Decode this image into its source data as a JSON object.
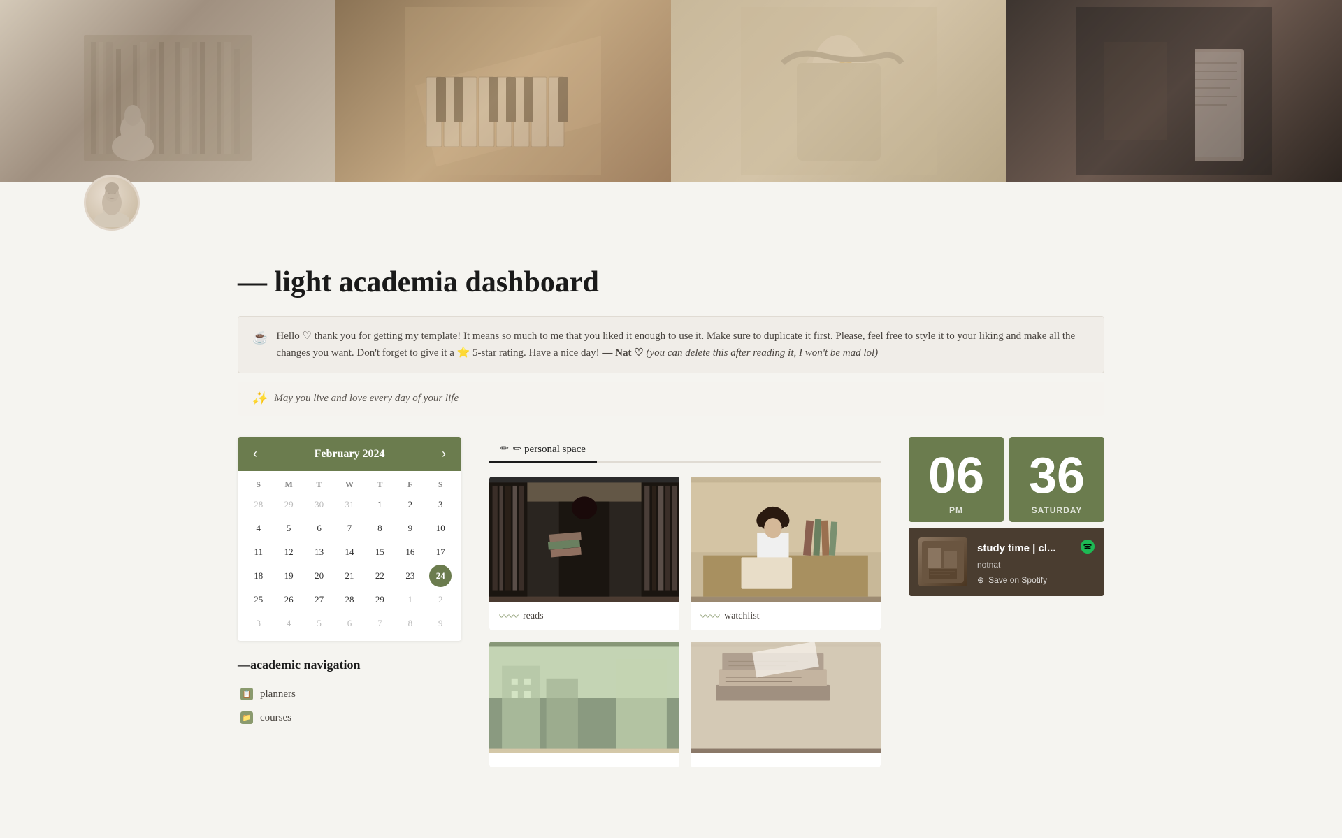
{
  "hero": {
    "panels": [
      {
        "label": "library",
        "emoji": "📚"
      },
      {
        "label": "piano",
        "emoji": "🎹"
      },
      {
        "label": "bag",
        "emoji": "👜"
      },
      {
        "label": "reading",
        "emoji": "📖"
      }
    ]
  },
  "bust": {
    "emoji": "🗿"
  },
  "page": {
    "title": "— light academia dashboard",
    "info_icon": "☕",
    "info_text": "Hello ♡ thank you for getting my template! It means so much to me that you liked it enough to use it. Make sure to duplicate it first. Please, feel free to style it to your liking and make all the changes you want. Don't forget to give it a ⭐ 5-star rating. Have a nice day!",
    "info_author": "— Nat ♡",
    "info_aside": "(you can delete this after reading it, I won't be mad lol)",
    "sparkle": "✨",
    "quote": "May you live and love every day of your life"
  },
  "calendar": {
    "month": "February 2024",
    "prev_label": "‹",
    "next_label": "›",
    "day_headers": [
      "S",
      "M",
      "T",
      "W",
      "T",
      "F",
      "S"
    ],
    "weeks": [
      [
        "28",
        "29",
        "30",
        "31",
        "1",
        "2",
        "3"
      ],
      [
        "4",
        "5",
        "6",
        "7",
        "8",
        "9",
        "10"
      ],
      [
        "11",
        "12",
        "13",
        "14",
        "15",
        "16",
        "17"
      ],
      [
        "18",
        "19",
        "20",
        "21",
        "22",
        "23",
        "24"
      ],
      [
        "25",
        "26",
        "27",
        "28",
        "29",
        "1",
        "2"
      ],
      [
        "3",
        "4",
        "5",
        "6",
        "7",
        "8",
        "9"
      ]
    ],
    "other_month_start": [
      "28",
      "29",
      "30",
      "31"
    ],
    "other_month_end_row4": [
      "1",
      "2"
    ],
    "other_month_end_row5": [
      "1",
      "2"
    ],
    "other_month_end_row6": [
      "3",
      "4",
      "5",
      "6",
      "7",
      "8",
      "9"
    ],
    "today": "24"
  },
  "academic_nav": {
    "title": "—academic navigation",
    "items": [
      {
        "label": "planners",
        "icon": "📋"
      },
      {
        "label": "courses",
        "icon": "📁"
      }
    ]
  },
  "personal_space": {
    "tabs": [
      {
        "label": "✏ personal space",
        "active": true
      }
    ],
    "photos": [
      {
        "label": "reads",
        "tilde": "〰〰"
      },
      {
        "label": "watchlist",
        "tilde": "〰〰"
      },
      {
        "label": "",
        "tilde": ""
      },
      {
        "label": "",
        "tilde": ""
      }
    ]
  },
  "clock": {
    "hour": "06",
    "minute": "36",
    "period": "PM",
    "day": "SATURDAY"
  },
  "spotify": {
    "logo": "●",
    "title": "study time | cl...",
    "artist": "notnat",
    "save_label": "Save on Spotify"
  }
}
